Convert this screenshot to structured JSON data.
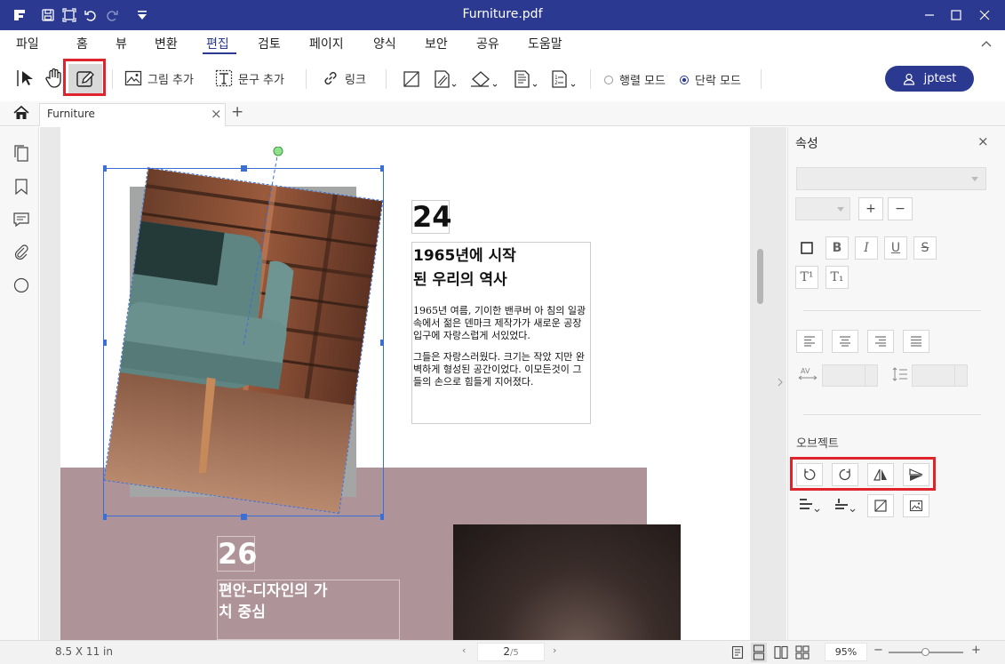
{
  "window": {
    "title": "Furniture.pdf"
  },
  "menu": [
    {
      "label": "파일"
    },
    {
      "label": "홈"
    },
    {
      "label": "뷰"
    },
    {
      "label": "변환"
    },
    {
      "label": "편집"
    },
    {
      "label": "검토"
    },
    {
      "label": "페이지"
    },
    {
      "label": "양식"
    },
    {
      "label": "보안"
    },
    {
      "label": "공유"
    },
    {
      "label": "도움말"
    }
  ],
  "toolbar": {
    "add_image": "그림 추가",
    "add_text": "문구 추가",
    "link": "링크",
    "line_mode": "행렬 모드",
    "paragraph_mode": "단락 모드"
  },
  "user": {
    "name": "jptest"
  },
  "tabs": [
    {
      "label": "Furniture",
      "close": "×"
    }
  ],
  "tab_add": "+",
  "document": {
    "number_24": "24",
    "heading_24_line1": "1965년에 시작",
    "heading_24_line2": "된 우리의 역사",
    "para1": "1965년 여름, 기이한 밴쿠버 아 침의 일광속에서 젊은 덴마크 제작가가 새로운 공장입구에 자랑스럽게 서있었다.",
    "para2": "그들은 자랑스러웠다. 크기는 작았 지만 완벽하게 형성된 공간이었다. 이모든것이 그들의 손으로 힘들게 지어졌다.",
    "number_26": "26",
    "heading_26_line1": "편안-디자인의 가",
    "heading_26_line2": "치 중심"
  },
  "right_panel": {
    "title": "속성",
    "close": "×",
    "plus": "+",
    "minus": "−",
    "bold": "B",
    "italic": "I",
    "underline": "U",
    "strike": "S",
    "superscript": "T¹",
    "subscript": "T₁",
    "object_label": "오브젝트"
  },
  "status": {
    "page_size": "8.5 X 11 in",
    "current_page": "2",
    "total_pages": "/5",
    "zoom": "95%",
    "zoom_minus": "−",
    "zoom_plus": "+"
  },
  "colors": {
    "title_bar": "#2b3990",
    "accent": "#2b3990",
    "highlight": "#e0242d",
    "mauve_band": "#ae9499",
    "selection": "#3b6fd6"
  }
}
